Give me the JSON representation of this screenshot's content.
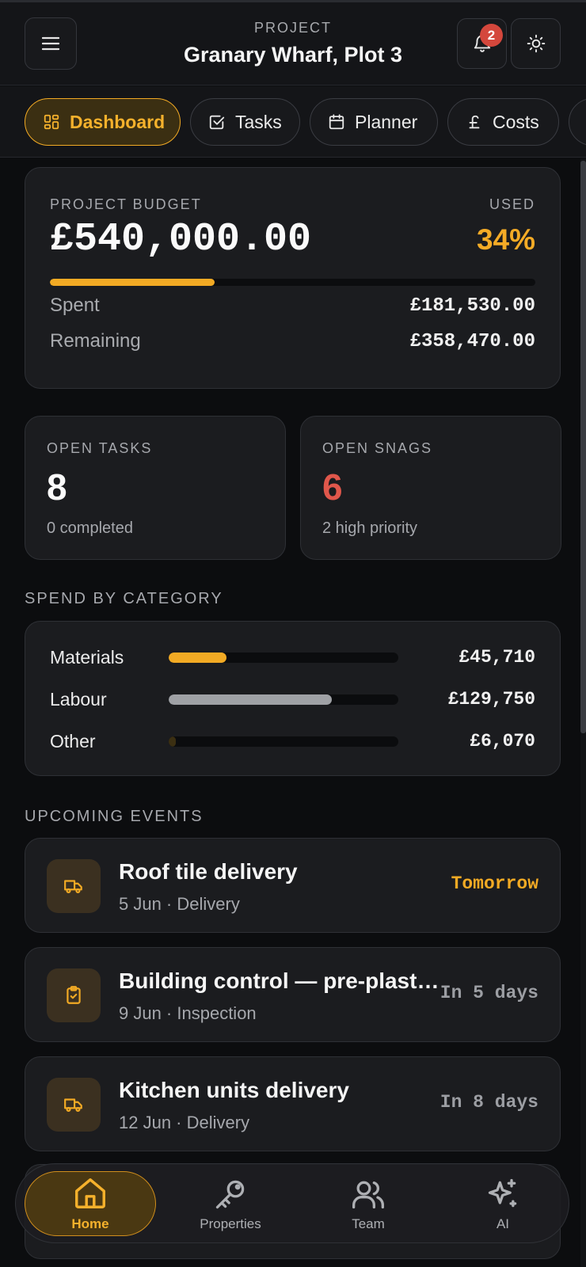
{
  "header": {
    "eyebrow": "PROJECT",
    "project_name": "Granary Wharf, Plot 3",
    "notifications_count": "2",
    "icons": [
      "menu-icon",
      "bell-icon",
      "sun-icon"
    ]
  },
  "tabs": [
    {
      "label": "Dashboard",
      "icon": "dashboard-icon",
      "active": true
    },
    {
      "label": "Tasks",
      "icon": "checkbox-icon",
      "active": false
    },
    {
      "label": "Planner",
      "icon": "calendar-icon",
      "active": false
    },
    {
      "label": "Costs",
      "icon": "pound-icon",
      "active": false
    }
  ],
  "budget": {
    "label": "PROJECT BUDGET",
    "amount": "£540,000.00",
    "used_label": "USED",
    "used_pct": "34%",
    "used_fraction": 0.34,
    "spent_label": "Spent",
    "spent_value": "£181,530.00",
    "remaining_label": "Remaining",
    "remaining_value": "£358,470.00"
  },
  "stats": {
    "tasks": {
      "label": "OPEN TASKS",
      "value": "8",
      "sub": "0 completed"
    },
    "snags": {
      "label": "OPEN SNAGS",
      "value": "6",
      "sub": "2 high priority"
    }
  },
  "spend": {
    "title": "SPEND BY CATEGORY",
    "items": [
      {
        "name": "Materials",
        "value": "£45,710",
        "fraction": 0.25,
        "color": "#f2aa24"
      },
      {
        "name": "Labour",
        "value": "£129,750",
        "fraction": 0.71,
        "color": "#9fa1a5"
      },
      {
        "name": "Other",
        "value": "£6,070",
        "fraction": 0.03,
        "color": "#3b2f12"
      }
    ]
  },
  "events": {
    "title": "UPCOMING EVENTS",
    "items": [
      {
        "title": "Roof tile delivery",
        "meta": "5 Jun · Delivery",
        "when": "Tomorrow",
        "icon": "truck-icon"
      },
      {
        "title": "Building control — pre-plaster inspection",
        "meta": "9 Jun · Inspection",
        "when": "In 5 days",
        "icon": "clipboard-check-icon"
      },
      {
        "title": "Kitchen units delivery",
        "meta": "12 Jun · Delivery",
        "when": "In 8 days",
        "icon": "truck-icon"
      }
    ]
  },
  "nav": [
    {
      "label": "Home",
      "icon": "home-icon",
      "active": true
    },
    {
      "label": "Properties",
      "icon": "key-icon",
      "active": false
    },
    {
      "label": "Team",
      "icon": "users-icon",
      "active": false
    },
    {
      "label": "AI",
      "icon": "sparkles-icon",
      "active": false
    }
  ],
  "colors": {
    "accent": "#f2aa24",
    "danger": "#d4473c",
    "background": "#0c0d0f",
    "card": "#1b1c1f"
  }
}
